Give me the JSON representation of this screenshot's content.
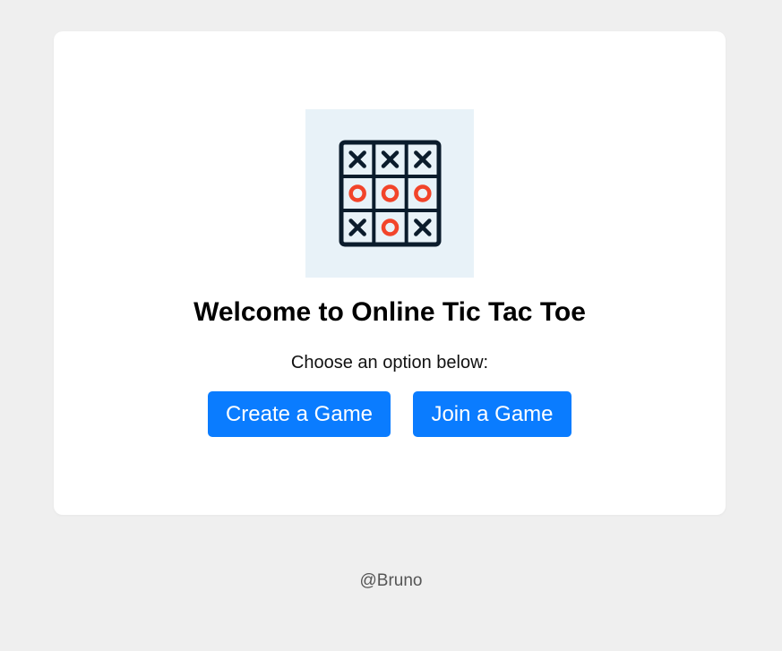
{
  "logo": {
    "icon": "tic-tac-toe-board-icon",
    "board": [
      [
        "X",
        "X",
        "X"
      ],
      [
        "O",
        "O",
        "O"
      ],
      [
        "X",
        "O",
        "X"
      ]
    ],
    "colors": {
      "background": "#e8f2f8",
      "x_and_grid": "#0b1c2c",
      "o": "#f2442a"
    }
  },
  "main": {
    "title": "Welcome to Online Tic Tac Toe",
    "subtitle": "Choose an option below:",
    "create_label": "Create a Game",
    "join_label": "Join a Game"
  },
  "footer": {
    "credit": "@Bruno"
  },
  "colors": {
    "page_background": "#efefef",
    "card_background": "#ffffff",
    "button_background": "#0a7cff",
    "button_text": "#ffffff"
  }
}
